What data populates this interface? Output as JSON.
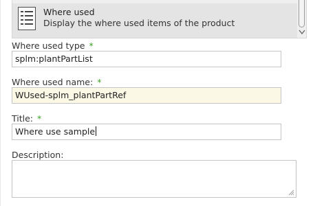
{
  "list": {
    "selected_item": {
      "icon": "document-list-icon",
      "title": "Where used",
      "description": "Display the where used items of the product"
    }
  },
  "form": {
    "where_used_type": {
      "label": "Where used type",
      "required_mark": "*",
      "value": "splm:plantPartList"
    },
    "where_used_name": {
      "label": "Where used name:",
      "required_mark": "*",
      "value": "WUsed-splm_plantPartRef"
    },
    "title": {
      "label": "Title:",
      "required_mark": "*",
      "value": "Where use sample"
    },
    "description": {
      "label": "Description:",
      "value": ""
    }
  },
  "colors": {
    "required_mark": "#3aa025",
    "highlight_field": "#fbf8e6",
    "selected_item_bg": "#e4e4e4"
  }
}
